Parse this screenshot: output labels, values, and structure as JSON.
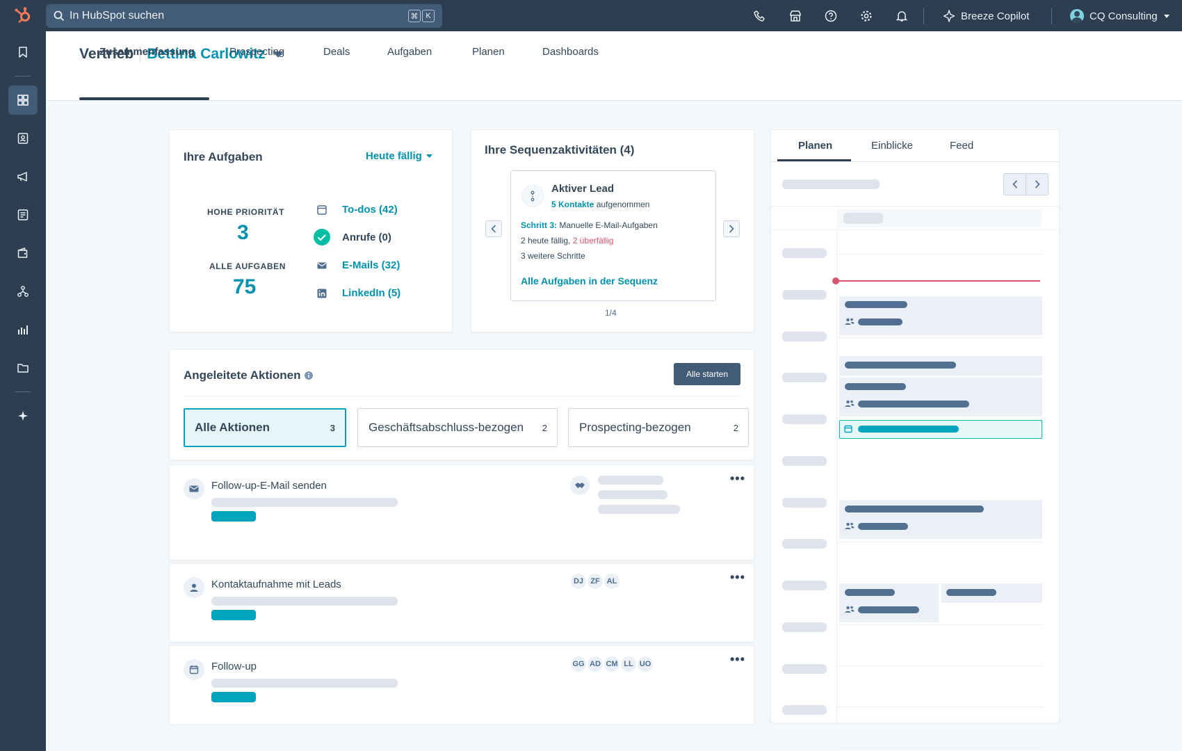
{
  "topbar": {
    "search_placeholder": "In HubSpot suchen",
    "kbd_cmd": "⌘",
    "kbd_k": "K",
    "copilot_label": "Breeze Copilot",
    "account_label": "CQ Consulting"
  },
  "header": {
    "section": "Vertrieb",
    "owner": "Bettina Carlowitz",
    "tabs": [
      "Zusammenfassung",
      "Prospecting",
      "Deals",
      "Aufgaben",
      "Planen",
      "Dashboards"
    ]
  },
  "tasks": {
    "title": "Ihre Aufgaben",
    "filter_label": "Heute fällig",
    "high_priority_label": "HOHE PRIORITÄT",
    "high_priority_value": "3",
    "all_tasks_label": "ALLE AUFGABEN",
    "all_tasks_value": "75",
    "items": [
      "To-dos (42)",
      "Anrufe (0)",
      "E-Mails (32)",
      "LinkedIn (5)"
    ]
  },
  "sequences": {
    "title": "Ihre Sequenzaktivitäten (4)",
    "card_title": "Aktiver Lead",
    "contacts_link": "5 Kontakte",
    "contacts_suffix": "aufgenommen",
    "step_label": "Schritt 3:",
    "step_text": "Manuelle E-Mail-Aufgaben",
    "due_text": "2 heute fällig,",
    "overdue_text": "2 überfällig",
    "more_steps": "3 weitere Schritte",
    "all_tasks_link": "Alle Aufgaben in der Sequenz",
    "pager": "1/4"
  },
  "guided": {
    "title": "Angeleitete Aktionen",
    "start_all": "Alle starten",
    "filters": [
      {
        "label": "Alle Aktionen",
        "count": "3"
      },
      {
        "label": "Geschäftsabschluss-bezogen",
        "count": "2"
      },
      {
        "label": "Prospecting-bezogen",
        "count": "2"
      }
    ],
    "actions": [
      {
        "title": "Follow-up-E-Mail senden",
        "avatars": []
      },
      {
        "title": "Kontaktaufnahme mit Leads",
        "avatars": [
          "DJ",
          "ZF",
          "AL"
        ]
      },
      {
        "title": "Follow-up",
        "avatars": [
          "GG",
          "AD",
          "CM",
          "LL",
          "UO"
        ]
      }
    ]
  },
  "right_panel": {
    "tabs": [
      "Planen",
      "Einblicke",
      "Feed"
    ]
  },
  "colors": {
    "nav_bg": "#2d3e50",
    "accent_teal": "#00a4bd",
    "link": "#0091ae",
    "overdue": "#d9536f",
    "success": "#00bda5"
  }
}
